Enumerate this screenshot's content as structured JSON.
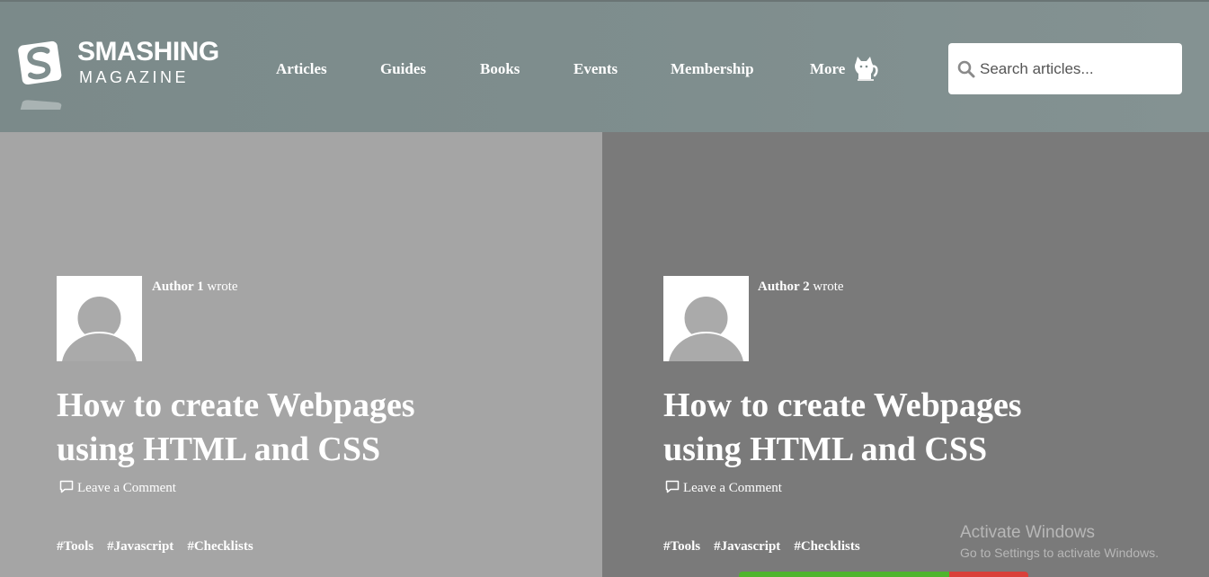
{
  "header": {
    "logo": {
      "word1": "SMASHING",
      "word2": "MAGAZINE"
    },
    "nav": [
      {
        "label": "Articles"
      },
      {
        "label": "Guides"
      },
      {
        "label": "Books"
      },
      {
        "label": "Events"
      },
      {
        "label": "Membership"
      },
      {
        "label": "More"
      }
    ],
    "search": {
      "placeholder": "Search articles...",
      "value": ""
    }
  },
  "articles": [
    {
      "author": "Author 1",
      "wrote": "wrote",
      "title": "How to create Webpages using HTML and CSS",
      "comment_label": "Leave a Comment",
      "tags": [
        "#Tools",
        "#Javascript",
        "#Checklists"
      ]
    },
    {
      "author": "Author 2",
      "wrote": "wrote",
      "title": "How to create Webpages using HTML and CSS",
      "comment_label": "Leave a Comment",
      "tags": [
        "#Tools",
        "#Javascript",
        "#Checklists"
      ]
    }
  ],
  "watermark": {
    "title": "Activate Windows",
    "subtitle": "Go to Settings to activate Windows."
  },
  "colors": {
    "header_bg": "#7f8e8e",
    "card1_bg": "#a5a5a5",
    "card2_bg": "#7a7a7a",
    "text": "#ffffff"
  }
}
